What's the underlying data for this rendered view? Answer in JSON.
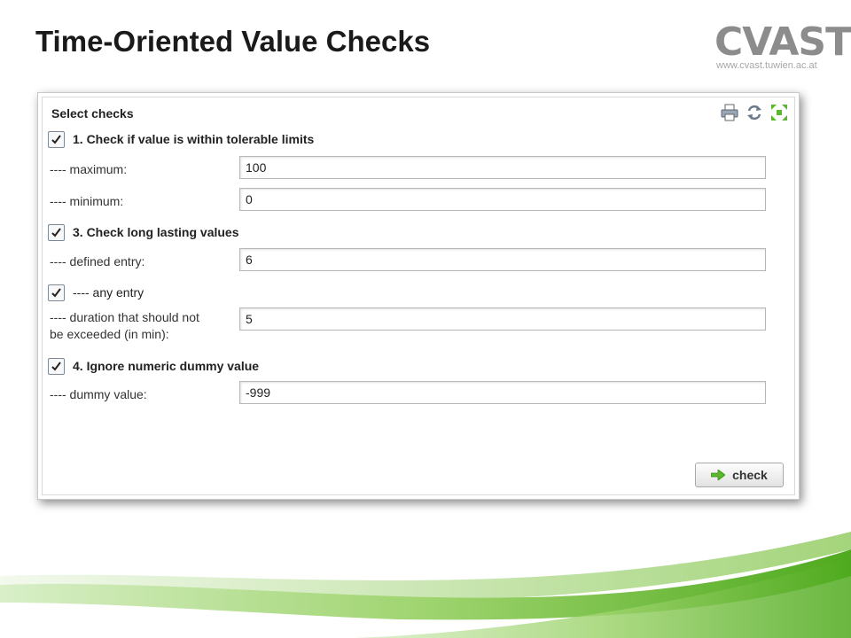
{
  "slide": {
    "title": "Time-Oriented Value Checks",
    "logo_text": "CVAST",
    "logo_url": "www.cvast.tuwien.ac.at"
  },
  "panel": {
    "title": "Select checks",
    "icons": [
      "printer-icon",
      "refresh-icon",
      "expand-icon"
    ]
  },
  "checks": {
    "check1": {
      "label": "1. Check if value is within tolerable limits",
      "checked": true
    },
    "maximum": {
      "label": "---- maximum:",
      "value": "100"
    },
    "minimum": {
      "label": "---- minimum:",
      "value": "0"
    },
    "check3": {
      "label": "3. Check long lasting values",
      "checked": true
    },
    "defined_entry": {
      "label": "---- defined entry:",
      "value": "6"
    },
    "any_entry": {
      "label": "---- any entry",
      "checked": true
    },
    "duration": {
      "label_line1": "---- duration that should not",
      "label_line2": "be exceeded (in min):",
      "value": "5"
    },
    "check4": {
      "label": "4. Ignore numeric dummy value",
      "checked": true
    },
    "dummy_value": {
      "label": "---- dummy value:",
      "value": "-999"
    }
  },
  "actions": {
    "check_label": "check"
  },
  "colors": {
    "accent_green": "#7dc242",
    "swoosh_green": "#5bb82e",
    "logo_gray": "#8c8c8c"
  }
}
